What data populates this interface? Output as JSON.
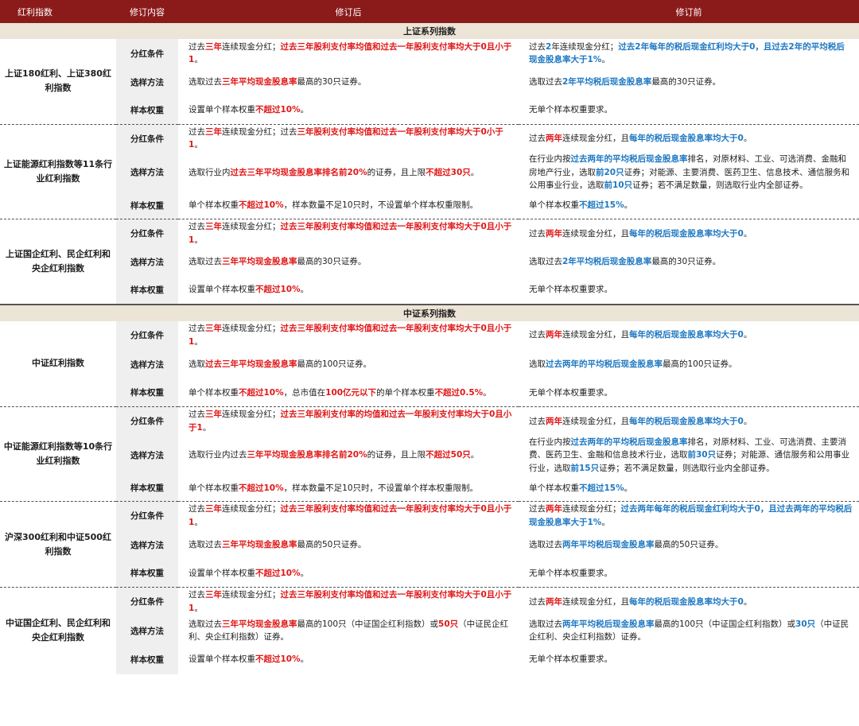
{
  "header": {
    "col1": "红利指数",
    "col2": "修订内容",
    "col3": "修订后",
    "col4": "修订前"
  },
  "sections": {
    "sse": "上证系列指数",
    "csi": "中证系列指数"
  },
  "rowLabels": {
    "div": "分红条件",
    "sel": "选样方法",
    "wt": "样本权重"
  },
  "groups": [
    {
      "name": "上证180红利、上证380红利指数",
      "rows": {
        "div": {
          "after": [
            [
              "过去"
            ],
            [
              "三年",
              "r"
            ],
            [
              "连续现金分红；"
            ],
            [
              "过去三年股利支付率均值和过去一年股利支付率均大于0且小于1",
              "r"
            ],
            [
              "。"
            ]
          ],
          "before": [
            [
              "过去"
            ],
            [
              "2",
              "b"
            ],
            [
              "年连续现金分红；"
            ],
            [
              "过去2年每年的税后现金红利均大于0，且过去2年的平均税后现金股息率大于1%",
              "b"
            ],
            [
              "。"
            ]
          ]
        },
        "sel": {
          "after": [
            [
              "选取过去"
            ],
            [
              "三年平均现金股息率",
              "r"
            ],
            [
              "最高的30只证券。"
            ]
          ],
          "before": [
            [
              "选取过去"
            ],
            [
              "2年平均税后现金股息率",
              "b"
            ],
            [
              "最高的30只证券。"
            ]
          ]
        },
        "wt": {
          "after": [
            [
              "设置单个样本权重"
            ],
            [
              "不超过10%",
              "r"
            ],
            [
              "。"
            ]
          ],
          "before": [
            [
              "无单个样本权重要求。"
            ]
          ]
        }
      }
    },
    {
      "name": "上证能源红利指数等11条行业红利指数",
      "rows": {
        "div": {
          "after": [
            [
              "过去"
            ],
            [
              "三年",
              "r"
            ],
            [
              "连续现金分红；过去"
            ],
            [
              "三年股利支付率均值和过去一年股利支付率均大于0小于1",
              "r"
            ],
            [
              "。"
            ]
          ],
          "before": [
            [
              "过去"
            ],
            [
              "两年",
              "r"
            ],
            [
              "连续现金分红，且"
            ],
            [
              "每年的税后现金股息率均大于0",
              "b"
            ],
            [
              "。"
            ]
          ]
        },
        "sel": {
          "after": [
            [
              "选取行业内"
            ],
            [
              "过去三年平均现金股息率排名前20%",
              "r"
            ],
            [
              "的证券，且上限"
            ],
            [
              "不超过30只",
              "r"
            ],
            [
              "。"
            ]
          ],
          "before": [
            [
              "在行业内按"
            ],
            [
              "过去两年的平均税后现金股息率",
              "b"
            ],
            [
              "排名，对原材料、工业、可选消费、金融和房地产行业，选取"
            ],
            [
              "前20只",
              "b"
            ],
            [
              "证券；对能源、主要消费、医药卫生、信息技术、通信服务和公用事业行业，选取"
            ],
            [
              "前10只",
              "b"
            ],
            [
              "证券；若不满足数量，则选取行业内全部证券。"
            ]
          ]
        },
        "wt": {
          "after": [
            [
              "单个样本权重"
            ],
            [
              "不超过10%",
              "r"
            ],
            [
              "，样本数量不足10只时，不设置单个样本权重限制。"
            ]
          ],
          "before": [
            [
              "单个样本权重"
            ],
            [
              "不超过15%",
              "b"
            ],
            [
              "。"
            ]
          ]
        }
      }
    },
    {
      "name": "上证国企红利、民企红利和央企红利指数",
      "rows": {
        "div": {
          "after": [
            [
              "过去"
            ],
            [
              "三年",
              "r"
            ],
            [
              "连续现金分红；"
            ],
            [
              "过去三年股利支付率均值和过去一年股利支付率均大于0且小于1",
              "r"
            ],
            [
              "。"
            ]
          ],
          "before": [
            [
              "过去"
            ],
            [
              "两年",
              "r"
            ],
            [
              "连续现金分红，且"
            ],
            [
              "每年的税后现金股息率均大于0",
              "b"
            ],
            [
              "。"
            ]
          ]
        },
        "sel": {
          "after": [
            [
              "选取过去"
            ],
            [
              "三年平均现金股息率",
              "r"
            ],
            [
              "最高的30只证券。"
            ]
          ],
          "before": [
            [
              "选取过去"
            ],
            [
              "2年平均税后现金股息率",
              "b"
            ],
            [
              "最高的30只证券。"
            ]
          ]
        },
        "wt": {
          "after": [
            [
              "设置单个样本权重"
            ],
            [
              "不超过10%",
              "r"
            ],
            [
              "。"
            ]
          ],
          "before": [
            [
              "无单个样本权重要求。"
            ]
          ]
        }
      }
    },
    {
      "name": "中证红利指数",
      "rows": {
        "div": {
          "after": [
            [
              "过去"
            ],
            [
              "三年",
              "r"
            ],
            [
              "连续现金分红；"
            ],
            [
              "过去三年股利支付率均值和过去一年股利支付率均大于0且小于1",
              "r"
            ],
            [
              "。"
            ]
          ],
          "before": [
            [
              "过去"
            ],
            [
              "两年",
              "r"
            ],
            [
              "连续现金分红，且"
            ],
            [
              "每年的税后现金股息率均大于0",
              "b"
            ],
            [
              "。"
            ]
          ]
        },
        "sel": {
          "after": [
            [
              "选取"
            ],
            [
              "过去三年平均现金股息率",
              "r"
            ],
            [
              "最高的100只证券。"
            ]
          ],
          "before": [
            [
              "选取"
            ],
            [
              "过去两年的平均税后现金股息率",
              "b"
            ],
            [
              "最高的100只证券。"
            ]
          ]
        },
        "wt": {
          "after": [
            [
              "单个样本权重"
            ],
            [
              "不超过10%",
              "r"
            ],
            [
              "，总市值在"
            ],
            [
              "100亿元以下",
              "r"
            ],
            [
              "的单个样本权重"
            ],
            [
              "不超过0.5%",
              "r"
            ],
            [
              "。"
            ]
          ],
          "before": [
            [
              "无单个样本权重要求。"
            ]
          ]
        }
      }
    },
    {
      "name": "中证能源红利指数等10条行业红利指数",
      "rows": {
        "div": {
          "after": [
            [
              "过去"
            ],
            [
              "三年",
              "r"
            ],
            [
              "连续现金分红；"
            ],
            [
              "过去三年股利支付率的均值和过去一年股利支付率均大于0且小于1",
              "r"
            ],
            [
              "。"
            ]
          ],
          "before": [
            [
              "过去"
            ],
            [
              "两年",
              "r"
            ],
            [
              "连续现金分红，且"
            ],
            [
              "每年的税后现金股息率均大于0",
              "b"
            ],
            [
              "。"
            ]
          ]
        },
        "sel": {
          "after": [
            [
              "选取行业内过去"
            ],
            [
              "三年平均现金股息率排名前20%",
              "r"
            ],
            [
              "的证券，且上限"
            ],
            [
              "不超过50只",
              "r"
            ],
            [
              "。"
            ]
          ],
          "before": [
            [
              "在行业内按"
            ],
            [
              "过去两年的平均税后现金股息率",
              "b"
            ],
            [
              "排名，对原材料、工业、可选消费、主要消费、医药卫生、金融和信息技术行业，选取"
            ],
            [
              "前30只",
              "b"
            ],
            [
              "证券；对能源、通信服务和公用事业行业，选取"
            ],
            [
              "前15只",
              "b"
            ],
            [
              "证券；若不满足数量，则选取行业内全部证券。"
            ]
          ]
        },
        "wt": {
          "after": [
            [
              "单个样本权重"
            ],
            [
              "不超过10%",
              "r"
            ],
            [
              "，样本数量不足10只时，不设置单个样本权重限制。"
            ]
          ],
          "before": [
            [
              "单个样本权重"
            ],
            [
              "不超过15%",
              "b"
            ],
            [
              "。"
            ]
          ]
        }
      }
    },
    {
      "name": "沪深300红利和中证500红利指数",
      "rows": {
        "div": {
          "after": [
            [
              "过去"
            ],
            [
              "三年",
              "r"
            ],
            [
              "连续现金分红；"
            ],
            [
              "过去三年股利支付率均值和过去一年股利支付率均大于0且小于1",
              "r"
            ],
            [
              "。"
            ]
          ],
          "before": [
            [
              "过去"
            ],
            [
              "两年",
              "r"
            ],
            [
              "连续现金分红；"
            ],
            [
              "过去两年每年的税后现金红利均大于0，且过去两年的平均税后现金股息率大于1%",
              "b"
            ],
            [
              "。"
            ]
          ]
        },
        "sel": {
          "after": [
            [
              "选取过去"
            ],
            [
              "三年平均现金股息率",
              "r"
            ],
            [
              "最高的50只证券。"
            ]
          ],
          "before": [
            [
              "选取过去"
            ],
            [
              "两年平均税后现金股息率",
              "b"
            ],
            [
              "最高的50只证券。"
            ]
          ]
        },
        "wt": {
          "after": [
            [
              "设置单个样本权重"
            ],
            [
              "不超过10%",
              "r"
            ],
            [
              "。"
            ]
          ],
          "before": [
            [
              "无单个样本权重要求。"
            ]
          ]
        }
      }
    },
    {
      "name": "中证国企红利、民企红利和央企红利指数",
      "rows": {
        "div": {
          "after": [
            [
              "过去"
            ],
            [
              "三年",
              "r"
            ],
            [
              "连续现金分红；"
            ],
            [
              "过去三年股利支付率均值和过去一年股利支付率均大于0且小于1",
              "r"
            ],
            [
              "。"
            ]
          ],
          "before": [
            [
              "过去"
            ],
            [
              "两年",
              "r"
            ],
            [
              "连续现金分红，且"
            ],
            [
              "每年的税后现金股息率均大于0",
              "b"
            ],
            [
              "。"
            ]
          ]
        },
        "sel": {
          "after": [
            [
              "选取过去"
            ],
            [
              "三年平均现金股息率",
              "r"
            ],
            [
              "最高的100只（中证国企红利指数）或"
            ],
            [
              "50只",
              "r"
            ],
            [
              "（中证民企红利、央企红利指数）证券。"
            ]
          ],
          "before": [
            [
              "选取过去"
            ],
            [
              "两年平均税后现金股息率",
              "b"
            ],
            [
              "最高的100只（中证国企红利指数）或"
            ],
            [
              "30只",
              "b"
            ],
            [
              "（中证民企红利、央企红利指数）证券。"
            ]
          ]
        },
        "wt": {
          "after": [
            [
              "设置单个样本权重"
            ],
            [
              "不超过10%",
              "r"
            ],
            [
              "。"
            ]
          ],
          "before": [
            [
              "无单个样本权重要求。"
            ]
          ]
        }
      }
    }
  ]
}
